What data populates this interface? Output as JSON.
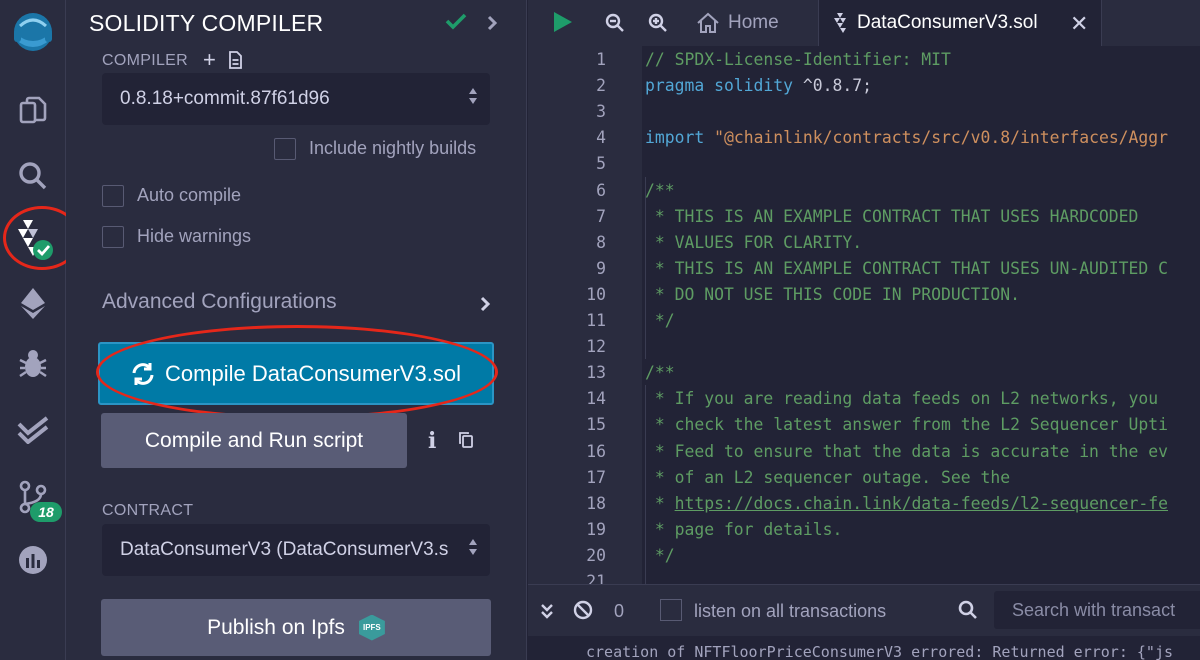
{
  "panel": {
    "title": "SOLIDITY COMPILER",
    "compiler_label": "COMPILER",
    "compiler_version": "0.8.18+commit.87f61d96",
    "nightly_label": "Include nightly builds",
    "auto_compile_label": "Auto compile",
    "hide_warnings_label": "Hide warnings",
    "advanced_label": "Advanced Configurations",
    "compile_button": "Compile DataConsumerV3.sol",
    "run_script_button": "Compile and Run script",
    "contract_label": "CONTRACT",
    "contract_value": "DataConsumerV3 (DataConsumerV3.s",
    "publish_button": "Publish on Ipfs",
    "ipfs_badge": "IPFS"
  },
  "rail": {
    "git_badge": "18",
    "icons": [
      "remix-logo-icon",
      "file-explorer-icon",
      "search-icon",
      "solidity-compiler-icon",
      "deploy-icon",
      "debugger-icon",
      "test-icon",
      "git-icon",
      "analytics-icon"
    ]
  },
  "tabs": {
    "home": "Home",
    "active": "DataConsumerV3.sol"
  },
  "editor": {
    "lines": [
      {
        "n": "1",
        "parts": [
          {
            "t": "// SPDX-License-Identifier: MIT",
            "c": "c-comment"
          }
        ]
      },
      {
        "n": "2",
        "parts": [
          {
            "t": "pragma solidity",
            "c": "c-kw"
          },
          {
            "t": " ^0.8.7;",
            "c": "c-plain"
          }
        ]
      },
      {
        "n": "3",
        "parts": []
      },
      {
        "n": "4",
        "parts": [
          {
            "t": "import",
            "c": "c-kw"
          },
          {
            "t": " ",
            "c": "c-plain"
          },
          {
            "t": "\"@chainlink/contracts/src/v0.8/interfaces/Aggr",
            "c": "c-str"
          }
        ]
      },
      {
        "n": "5",
        "parts": []
      },
      {
        "n": "6",
        "parts": [
          {
            "t": "/**",
            "c": "c-comment"
          }
        ]
      },
      {
        "n": "7",
        "parts": [
          {
            "t": " * THIS IS AN EXAMPLE CONTRACT THAT USES HARDCODED",
            "c": "c-comment"
          }
        ]
      },
      {
        "n": "8",
        "parts": [
          {
            "t": " * VALUES FOR CLARITY.",
            "c": "c-comment"
          }
        ]
      },
      {
        "n": "9",
        "parts": [
          {
            "t": " * THIS IS AN EXAMPLE CONTRACT THAT USES UN-AUDITED C",
            "c": "c-comment"
          }
        ]
      },
      {
        "n": "10",
        "parts": [
          {
            "t": " * DO NOT USE THIS CODE IN PRODUCTION.",
            "c": "c-comment"
          }
        ]
      },
      {
        "n": "11",
        "parts": [
          {
            "t": " */",
            "c": "c-comment"
          }
        ]
      },
      {
        "n": "12",
        "parts": []
      },
      {
        "n": "13",
        "parts": [
          {
            "t": "/**",
            "c": "c-comment"
          }
        ]
      },
      {
        "n": "14",
        "parts": [
          {
            "t": " * If you are reading data feeds on L2 networks, you",
            "c": "c-comment"
          }
        ]
      },
      {
        "n": "15",
        "parts": [
          {
            "t": " * check the latest answer from the L2 Sequencer Upti",
            "c": "c-comment"
          }
        ]
      },
      {
        "n": "16",
        "parts": [
          {
            "t": " * Feed to ensure that the data is accurate in the ev",
            "c": "c-comment"
          }
        ]
      },
      {
        "n": "17",
        "parts": [
          {
            "t": " * of an L2 sequencer outage. See the",
            "c": "c-comment"
          }
        ]
      },
      {
        "n": "18",
        "parts": [
          {
            "t": " * ",
            "c": "c-comment"
          },
          {
            "t": "https://docs.chain.link/data-feeds/l2-sequencer-fe",
            "c": "c-link"
          }
        ]
      },
      {
        "n": "19",
        "parts": [
          {
            "t": " * page for details.",
            "c": "c-comment"
          }
        ]
      },
      {
        "n": "20",
        "parts": [
          {
            "t": " */",
            "c": "c-comment"
          }
        ]
      },
      {
        "n": "21",
        "parts": []
      }
    ]
  },
  "terminal": {
    "count": "0",
    "listen_label": "listen on all transactions",
    "search_placeholder": "Search with transact",
    "output": "creation of NFTFloorPriceConsumerV3 errored: Returned error: {\"js"
  },
  "colors": {
    "accent": "#007aa6",
    "success": "#1e9c6a",
    "annotation": "#e5271a",
    "comment": "#5e9c63",
    "keyword": "#52a7d6",
    "string": "#ce8f5e"
  }
}
